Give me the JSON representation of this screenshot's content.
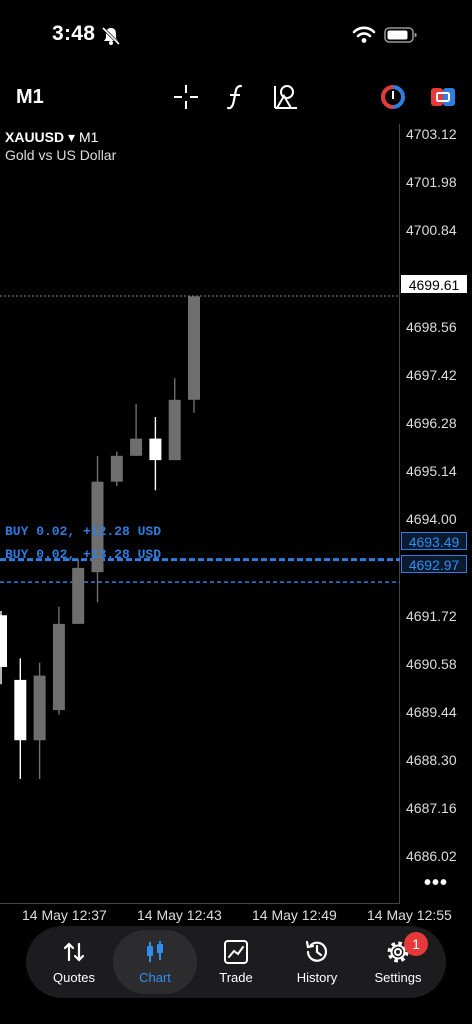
{
  "status_bar": {
    "time": "3:48"
  },
  "toolbar": {
    "timeframe": "M1"
  },
  "symbol": {
    "ticker": "XAUUSD",
    "caret": "▾",
    "timeframe": "M1",
    "description": "Gold vs US Dollar"
  },
  "price_axis": {
    "ticks": [
      "4703.12",
      "4701.98",
      "4700.84",
      "4698.56",
      "4697.42",
      "4696.28",
      "4695.14",
      "4694.00",
      "4691.72",
      "4690.58",
      "4689.44",
      "4688.30",
      "4687.16",
      "4686.02"
    ],
    "current_price": "4699.61",
    "buy_level_1": "4693.49",
    "buy_level_2": "4692.97"
  },
  "time_axis": {
    "ticks": [
      "14 May 12:37",
      "14 May 12:43",
      "14 May 12:49",
      "14 May 12:55"
    ]
  },
  "trades": [
    {
      "label": "BUY 0.02, +12.28 USD",
      "price": 4693.49
    },
    {
      "label": "BUY 0.02, +13.28 USD",
      "price": 4692.97
    }
  ],
  "chart_data": {
    "type": "candlestick",
    "ylim": [
      4685.5,
      4703.6
    ],
    "candles": [
      {
        "open": 4691.0,
        "close": 4692.2,
        "high": 4692.3,
        "low": 4690.6,
        "color": "white"
      },
      {
        "open": 4689.3,
        "close": 4690.7,
        "high": 4691.2,
        "low": 4688.4,
        "color": "white"
      },
      {
        "open": 4690.8,
        "close": 4689.3,
        "high": 4691.1,
        "low": 4688.4,
        "color": "gray"
      },
      {
        "open": 4690.0,
        "close": 4692.0,
        "high": 4692.4,
        "low": 4689.9,
        "color": "gray"
      },
      {
        "open": 4692.0,
        "close": 4693.3,
        "high": 4693.5,
        "low": 4692.0,
        "color": "gray"
      },
      {
        "open": 4693.2,
        "close": 4695.3,
        "high": 4695.9,
        "low": 4692.5,
        "color": "gray"
      },
      {
        "open": 4695.3,
        "close": 4695.9,
        "high": 4696.0,
        "low": 4695.2,
        "color": "gray"
      },
      {
        "open": 4695.9,
        "close": 4696.3,
        "high": 4697.1,
        "low": 4695.9,
        "color": "gray"
      },
      {
        "open": 4696.3,
        "close": 4695.8,
        "high": 4696.8,
        "low": 4695.1,
        "color": "white"
      },
      {
        "open": 4695.8,
        "close": 4697.2,
        "high": 4697.7,
        "low": 4695.8,
        "color": "gray"
      },
      {
        "open": 4697.2,
        "close": 4699.6,
        "high": 4699.6,
        "low": 4696.9,
        "color": "gray"
      }
    ]
  },
  "tabs": [
    {
      "label": "Quotes"
    },
    {
      "label": "Chart"
    },
    {
      "label": "Trade"
    },
    {
      "label": "History"
    },
    {
      "label": "Settings"
    }
  ],
  "settings_badge": "1",
  "colors": {
    "accent": "#2f8ff0",
    "trade_line": "#2f7de1",
    "candle_gray": "#6e6e6e",
    "badge": "#e5393a"
  }
}
